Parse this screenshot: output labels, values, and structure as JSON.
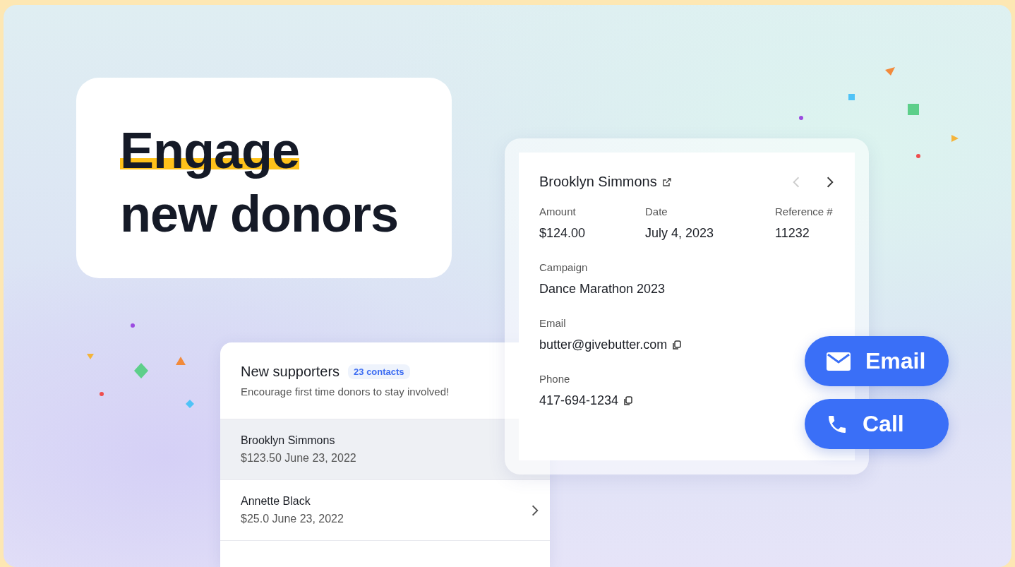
{
  "headline": {
    "lines": [
      {
        "text": "Engage",
        "highlighted": true
      },
      {
        "text": "new donors",
        "highlighted": false
      }
    ]
  },
  "supporters": {
    "title": "New supporters",
    "badge": "23 contacts",
    "subtitle": "Encourage first time donors to stay involved!",
    "rows": [
      {
        "name": "Brooklyn Simmons",
        "detail": "$123.50 June 23, 2022",
        "selected": true
      },
      {
        "name": "Annette Black",
        "detail": "$25.0 June 23, 2022",
        "selected": false
      }
    ]
  },
  "detail": {
    "name": "Brooklyn Simmons",
    "nav": [
      {
        "kind": "prev",
        "disabled": true
      },
      {
        "kind": "next",
        "disabled": false
      }
    ],
    "rows": [
      [
        {
          "label": "Amount",
          "value": "$124.00",
          "copyable": false
        },
        {
          "label": "Date",
          "value": "July 4, 2023",
          "copyable": false
        },
        {
          "label": "Reference #",
          "value": "11232",
          "copyable": false
        }
      ],
      [
        {
          "label": "Campaign",
          "value": "Dance Marathon 2023",
          "copyable": false
        }
      ],
      [
        {
          "label": "Email",
          "value": "butter@givebutter.com",
          "copyable": true
        }
      ],
      [
        {
          "label": "Phone",
          "value": "417-694-1234",
          "copyable": true
        }
      ]
    ]
  },
  "actions": [
    {
      "kind": "email",
      "label": "Email"
    },
    {
      "kind": "call",
      "label": "Call"
    }
  ]
}
